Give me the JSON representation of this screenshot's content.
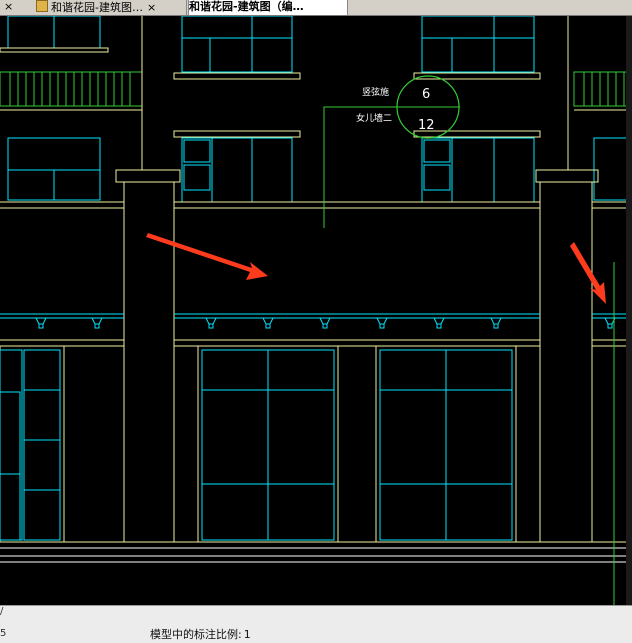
{
  "tabs": [
    {
      "label": "",
      "close": "×"
    },
    {
      "label": "和谐花园-建筑图…",
      "close": "×"
    },
    {
      "label": "和谐花园-建筑图（编…",
      "close": ""
    }
  ],
  "drawing": {
    "label_top": "竖弦施",
    "label_bottom": "女儿墙二",
    "marker_top": "6",
    "marker_bottom": "12",
    "colors": {
      "background": "#000000",
      "wall": "#f0f0a0",
      "window": "#00e5ff",
      "leader": "#33cc33",
      "arrow": "#ff3b1e",
      "white": "#ffffff"
    }
  },
  "status": {
    "command_prefix": "/",
    "left_text": "5",
    "scale_label": "模型中的标注比例:",
    "scale_value": "1"
  }
}
